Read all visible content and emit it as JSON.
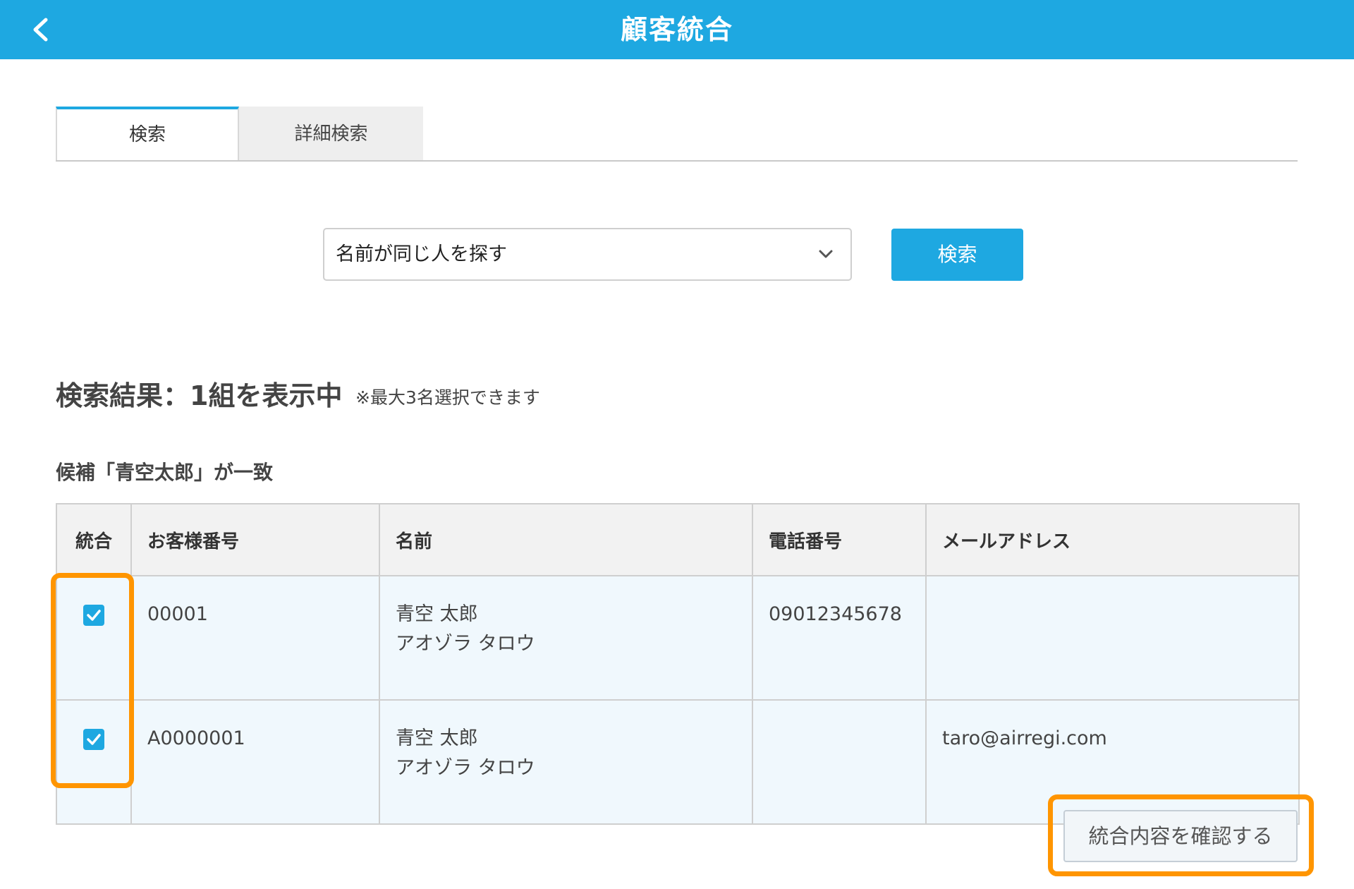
{
  "header": {
    "title": "顧客統合",
    "back_icon": "chevron-left-icon"
  },
  "tabs": [
    {
      "label": "検索",
      "active": true
    },
    {
      "label": "詳細検索",
      "active": false
    }
  ],
  "search": {
    "selected_option": "名前が同じ人を探す",
    "button_label": "検索"
  },
  "results": {
    "title": "検索結果：1組を表示中",
    "note": "※最大3名選択できます",
    "candidate_label": "候補「青空太郎」が一致",
    "columns": [
      "統合",
      "お客様番号",
      "名前",
      "電話番号",
      "メールアドレス"
    ],
    "rows": [
      {
        "checked": true,
        "customer_no": "00001",
        "name": "青空 太郎",
        "kana": "アオゾラ タロウ",
        "phone": "09012345678",
        "email": ""
      },
      {
        "checked": true,
        "customer_no": "A0000001",
        "name": "青空 太郎",
        "kana": "アオゾラ タロウ",
        "phone": "",
        "email": "taro@airregi.com"
      }
    ]
  },
  "confirm_button": "統合内容を確認する",
  "colors": {
    "brand": "#1ea8e1",
    "highlight": "#ff9500",
    "row_bg": "#f0f8fd"
  }
}
